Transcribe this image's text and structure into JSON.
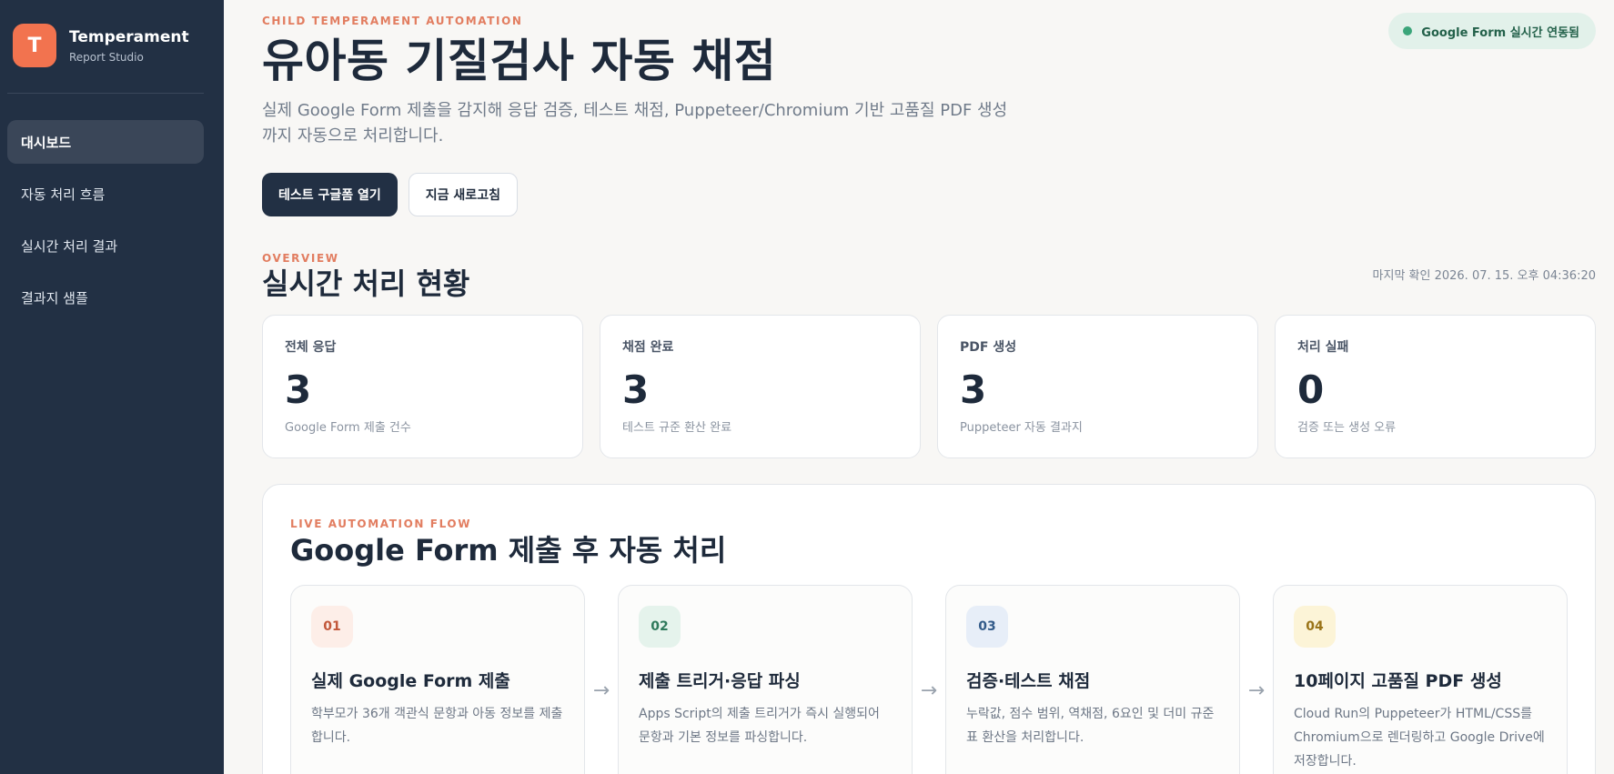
{
  "sidebar": {
    "logo_letter": "T",
    "brand_name": "Temperament",
    "brand_sub": "Report Studio",
    "items": [
      {
        "label": "대시보드",
        "active": true
      },
      {
        "label": "자동 처리 흐름",
        "active": false
      },
      {
        "label": "실시간 처리 결과",
        "active": false
      },
      {
        "label": "결과지 샘플",
        "active": false
      }
    ]
  },
  "hero": {
    "eyebrow": "CHILD TEMPERAMENT AUTOMATION",
    "title": "유아동 기질검사 자동 채점",
    "description": "실제 Google Form 제출을 감지해 응답 검증, 테스트 채점, Puppeteer/Chromium 기반 고품질 PDF 생성까지 자동으로 처리합니다.",
    "status_badge": "Google Form 실시간 연동됨",
    "primary_button": "테스트 구글폼 열기",
    "secondary_button": "지금 새로고침"
  },
  "overview": {
    "eyebrow": "OVERVIEW",
    "title": "실시간 처리 현황",
    "last_checked": "마지막 확인 2026. 07. 15. 오후 04:36:20",
    "stats": [
      {
        "label": "전체 응답",
        "value": "3",
        "sub": "Google Form 제출 건수"
      },
      {
        "label": "채점 완료",
        "value": "3",
        "sub": "테스트 규준 환산 완료"
      },
      {
        "label": "PDF 생성",
        "value": "3",
        "sub": "Puppeteer 자동 결과지"
      },
      {
        "label": "처리 실패",
        "value": "0",
        "sub": "검증 또는 생성 오류"
      }
    ]
  },
  "flow": {
    "eyebrow": "LIVE AUTOMATION FLOW",
    "title": "Google Form 제출 후 자동 처리",
    "steps": [
      {
        "num": "01",
        "title": "실제 Google Form 제출",
        "desc": "학부모가 36개 객관식 문항과 아동 정보를 제출합니다.",
        "color": "#c2573a",
        "bg": "#fdeee8"
      },
      {
        "num": "02",
        "title": "제출 트리거·응답 파싱",
        "desc": "Apps Script의 제출 트리거가 즉시 실행되어 문항과 기본 정보를 파싱합니다.",
        "color": "#2f7a5c",
        "bg": "#e5f3ec"
      },
      {
        "num": "03",
        "title": "검증·테스트 채점",
        "desc": "누락값, 점수 범위, 역채점, 6요인 및 더미 규준표 환산을 처리합니다.",
        "color": "#335b8a",
        "bg": "#e7eef8"
      },
      {
        "num": "04",
        "title": "10페이지 고품질 PDF 생성",
        "desc": "Cloud Run의 Puppeteer가 HTML/CSS를 Chromium으로 렌더링하고 Google Drive에 저장합니다.",
        "color": "#9a7418",
        "bg": "#fcf4d7"
      }
    ],
    "arrow_icon": "→"
  },
  "colors": {
    "accent": "#f2734f",
    "sidebar": "#223044",
    "success": "#3ba57a"
  }
}
